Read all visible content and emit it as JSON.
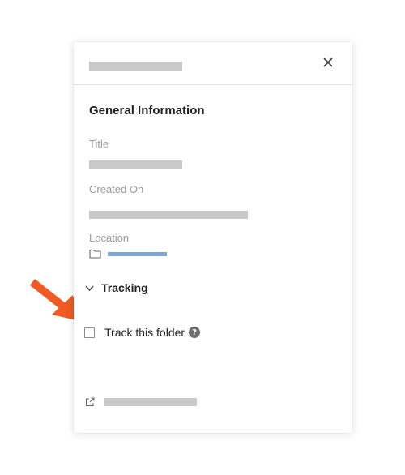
{
  "panel": {
    "title": "",
    "close_icon": "close-icon",
    "section_title": "General Information",
    "fields": {
      "title_label": "Title",
      "created_label": "Created On",
      "location_label": "Location",
      "location_icon": "folder-icon"
    }
  },
  "tracking": {
    "section_label": "Tracking",
    "toggle_icon": "chevron-down-icon",
    "checkbox_label": "Track this folder",
    "checked": false,
    "help_icon": "help-icon",
    "help_glyph": "?"
  },
  "footer": {
    "link_icon": "external-link-icon"
  },
  "colors": {
    "placeholder_bar": "#c9c9c9",
    "link_bar": "#7aa5d6",
    "annotation_arrow": "#f15a22",
    "text_dark": "#222222",
    "text_muted": "#9a9a9a"
  }
}
